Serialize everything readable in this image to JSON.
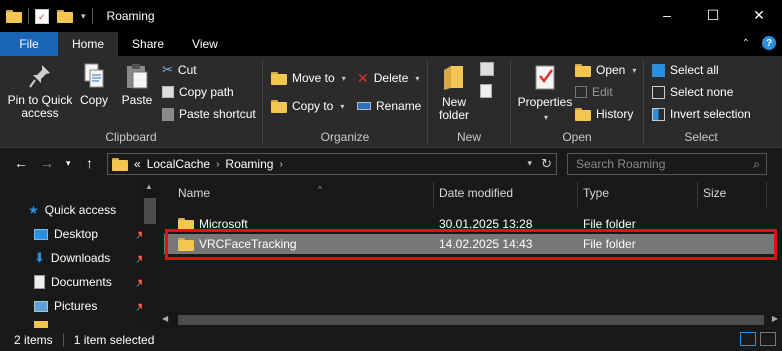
{
  "window": {
    "title": "Roaming",
    "controls": {
      "minimize": "–",
      "maximize": "☐",
      "close": "✕"
    }
  },
  "ribbon_tabs": [
    {
      "label": "File"
    },
    {
      "label": "Home"
    },
    {
      "label": "Share"
    },
    {
      "label": "View"
    }
  ],
  "ribbon": {
    "clipboard": {
      "label": "Clipboard",
      "pin": "Pin to Quick access",
      "copy": "Copy",
      "paste": "Paste",
      "cut": "Cut",
      "copy_path": "Copy path",
      "paste_shortcut": "Paste shortcut"
    },
    "organize": {
      "label": "Organize",
      "move_to": "Move to",
      "copy_to": "Copy to",
      "delete": "Delete",
      "rename": "Rename"
    },
    "new": {
      "label": "New",
      "new_folder": "New folder"
    },
    "open": {
      "label": "Open",
      "properties": "Properties",
      "open": "Open",
      "edit": "Edit",
      "history": "History"
    },
    "select": {
      "label": "Select",
      "select_all": "Select all",
      "select_none": "Select none",
      "invert": "Invert selection"
    }
  },
  "address": {
    "overflow": "«",
    "crumbs": [
      "LocalCache",
      "Roaming"
    ],
    "search_placeholder": "Search Roaming"
  },
  "nav": {
    "items": [
      {
        "label": "Quick access"
      },
      {
        "label": "Desktop"
      },
      {
        "label": "Downloads"
      },
      {
        "label": "Documents"
      },
      {
        "label": "Pictures"
      }
    ]
  },
  "columns": {
    "name": "Name",
    "date": "Date modified",
    "type": "Type",
    "size": "Size"
  },
  "files": [
    {
      "name": "Microsoft",
      "date": "30.01.2025 13:28",
      "type": "File folder",
      "selected": false
    },
    {
      "name": "VRCFaceTracking",
      "date": "14.02.2025 14:43",
      "type": "File folder",
      "selected": true
    }
  ],
  "status": {
    "count": "2 items",
    "selected": "1 item selected"
  },
  "colors": {
    "file_tab": "#1a64b4",
    "selection": "#777777",
    "highlight_box": "#e01010",
    "folder": "#f2c64f"
  }
}
